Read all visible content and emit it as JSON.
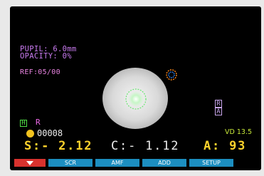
{
  "readout": {
    "pupil": "PUPIL: 6.0mm",
    "opacity": "OPACITY:  0%",
    "ref": "REF:05/00"
  },
  "indicators": {
    "h_box": "H",
    "r_label": "R",
    "r_box": "R",
    "a_box": "A",
    "vd": "VD 13.5",
    "counter": "00008"
  },
  "measurement": {
    "sph": "S:- 2.12",
    "cyl": "C:- 1.12",
    "axis": "A: 93"
  },
  "function_keys": {
    "f1": "",
    "f2": "SCR",
    "f3": "AMF",
    "f4": "ADD",
    "f5": "SETUP"
  },
  "colors": {
    "screen_bg": "#000000",
    "key_active": "#d8322e",
    "key_default": "#1c8ec0",
    "measure_highlight": "#ffd32c"
  }
}
